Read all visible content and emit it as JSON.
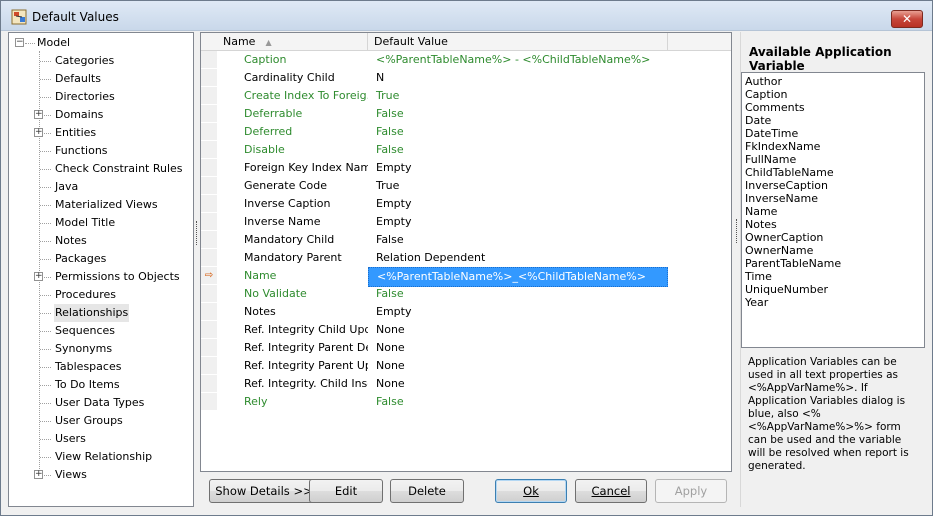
{
  "window": {
    "title": "Default Values",
    "close_label": "✕"
  },
  "tree": {
    "root": "Model",
    "items": [
      {
        "label": "Categories",
        "expandable": false
      },
      {
        "label": "Defaults",
        "expandable": false
      },
      {
        "label": "Directories",
        "expandable": false
      },
      {
        "label": "Domains",
        "expandable": true
      },
      {
        "label": "Entities",
        "expandable": true
      },
      {
        "label": "Functions",
        "expandable": false
      },
      {
        "label": "Check Constraint Rules",
        "expandable": false
      },
      {
        "label": "Java",
        "expandable": false
      },
      {
        "label": "Materialized Views",
        "expandable": false
      },
      {
        "label": "Model Title",
        "expandable": false
      },
      {
        "label": "Notes",
        "expandable": false
      },
      {
        "label": "Packages",
        "expandable": false
      },
      {
        "label": "Permissions to Objects",
        "expandable": true
      },
      {
        "label": "Procedures",
        "expandable": false
      },
      {
        "label": "Relationships",
        "expandable": false,
        "selected": true
      },
      {
        "label": "Sequences",
        "expandable": false
      },
      {
        "label": "Synonyms",
        "expandable": false
      },
      {
        "label": "Tablespaces",
        "expandable": false
      },
      {
        "label": "To Do Items",
        "expandable": false
      },
      {
        "label": "User Data Types",
        "expandable": false
      },
      {
        "label": "User Groups",
        "expandable": false
      },
      {
        "label": "Users",
        "expandable": false
      },
      {
        "label": "View Relationship",
        "expandable": false
      },
      {
        "label": "Views",
        "expandable": true
      }
    ]
  },
  "grid": {
    "columns": [
      "Name",
      "Default Value"
    ],
    "rows": [
      {
        "name": "Caption",
        "value": "<%ParentTableName%> - <%ChildTableName%>",
        "color": "green"
      },
      {
        "name": "Cardinality Child",
        "value": "N",
        "color": "black"
      },
      {
        "name": "Create Index To Foreig...",
        "value": "True",
        "color": "green"
      },
      {
        "name": "Deferrable",
        "value": "False",
        "color": "green"
      },
      {
        "name": "Deferred",
        "value": "False",
        "color": "green"
      },
      {
        "name": "Disable",
        "value": "False",
        "color": "green"
      },
      {
        "name": "Foreign Key Index Name",
        "value": "Empty",
        "color": "black"
      },
      {
        "name": "Generate Code",
        "value": "True",
        "color": "black"
      },
      {
        "name": "Inverse Caption",
        "value": "Empty",
        "color": "black"
      },
      {
        "name": "Inverse Name",
        "value": "Empty",
        "color": "black"
      },
      {
        "name": "Mandatory Child",
        "value": "False",
        "color": "black"
      },
      {
        "name": "Mandatory Parent",
        "value": "Relation Dependent",
        "color": "black"
      },
      {
        "name": "Name",
        "value": "<%ParentTableName%>_<%ChildTableName%>",
        "color": "green",
        "current": true
      },
      {
        "name": "No Validate",
        "value": "False",
        "color": "green"
      },
      {
        "name": "Notes",
        "value": "Empty",
        "color": "black"
      },
      {
        "name": "Ref. Integrity Child Upd...",
        "value": "None",
        "color": "black"
      },
      {
        "name": "Ref. Integrity Parent De...",
        "value": "None",
        "color": "black"
      },
      {
        "name": "Ref. Integrity Parent Up...",
        "value": "None",
        "color": "black"
      },
      {
        "name": "Ref. Integrity. Child Insert",
        "value": "None",
        "color": "black"
      },
      {
        "name": "Rely",
        "value": "False",
        "color": "green"
      }
    ]
  },
  "variables": {
    "title": "Available Application Variable",
    "items": [
      "Author",
      "Caption",
      "Comments",
      "Date",
      "DateTime",
      "FkIndexName",
      "FullName",
      "ChildTableName",
      "InverseCaption",
      "InverseName",
      "Name",
      "Notes",
      "OwnerCaption",
      "OwnerName",
      "ParentTableName",
      "Time",
      "UniqueNumber",
      "Year"
    ],
    "help": "Application Variables can be used in all text properties as <%AppVarName%>. If Application Variables dialog is blue, also <%<%AppVarName%>%> form can be used and the variable will be resolved when report is generated."
  },
  "buttons": {
    "show_details": "Show Details >>",
    "edit": "Edit",
    "delete": "Delete",
    "ok": "Ok",
    "cancel": "Cancel",
    "apply": "Apply"
  },
  "colors": {
    "green_text": "#2e8b2e",
    "selection": "#3399ff",
    "arrow": "#d35400"
  }
}
